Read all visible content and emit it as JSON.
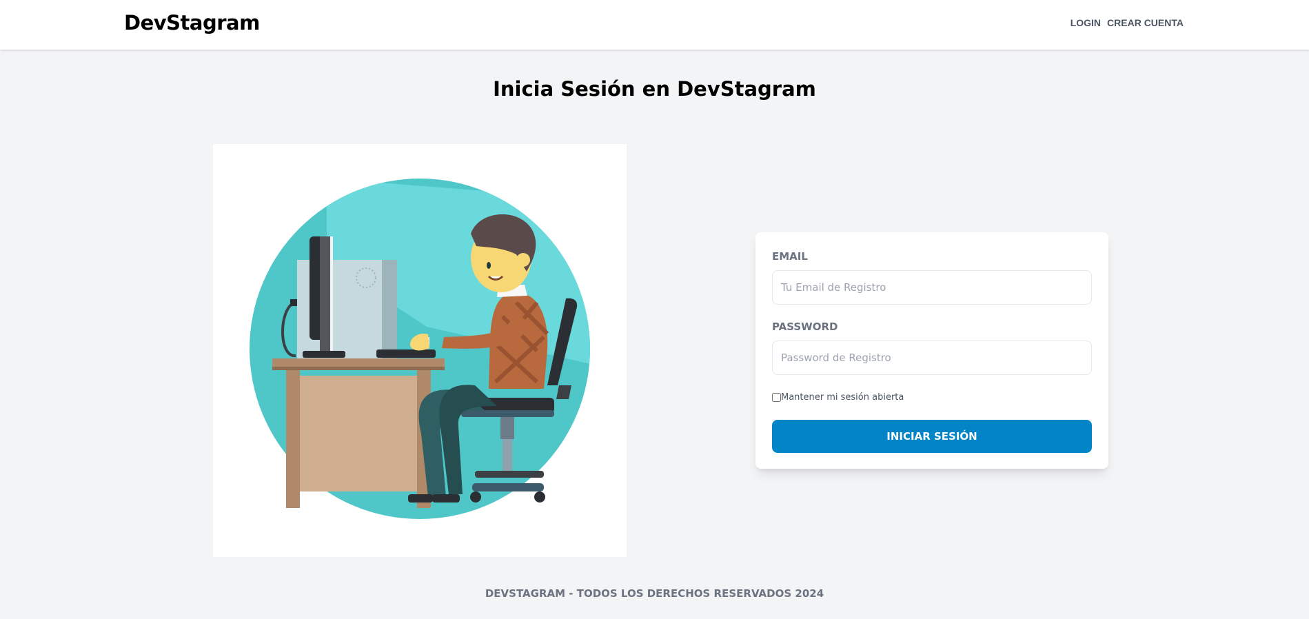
{
  "header": {
    "brand": "DevStagram",
    "nav": {
      "login": "Login",
      "register": "Crear Cuenta"
    }
  },
  "main": {
    "title": "Inicia Sesión en DevStagram",
    "illustration": {
      "icon": "person-at-computer-illustration",
      "colors": {
        "circle": "#4fc6c7",
        "circle_light": "#6ad9dc",
        "desk": "#b08a68",
        "desk_front": "#cfae90",
        "shirt": "#b86a3e",
        "pants": "#2f5f62",
        "chair": "#2b2e33",
        "skin": "#f7d774",
        "hair": "#5a4a4a"
      }
    },
    "form": {
      "email_label": "Email",
      "email_placeholder": "Tu Email de Registro",
      "password_label": "Password",
      "password_placeholder": "Password de Registro",
      "remember_label": "Mantener mi sesión abierta",
      "remember_checked": false,
      "submit_label": "Iniciar Sesión"
    }
  },
  "footer": {
    "text": "DevStagram - Todos los derechos reservados 2024"
  },
  "colors": {
    "background": "#f3f4f6",
    "primary": "#0284c7",
    "card": "#ffffff",
    "muted_text": "#6b7280"
  }
}
